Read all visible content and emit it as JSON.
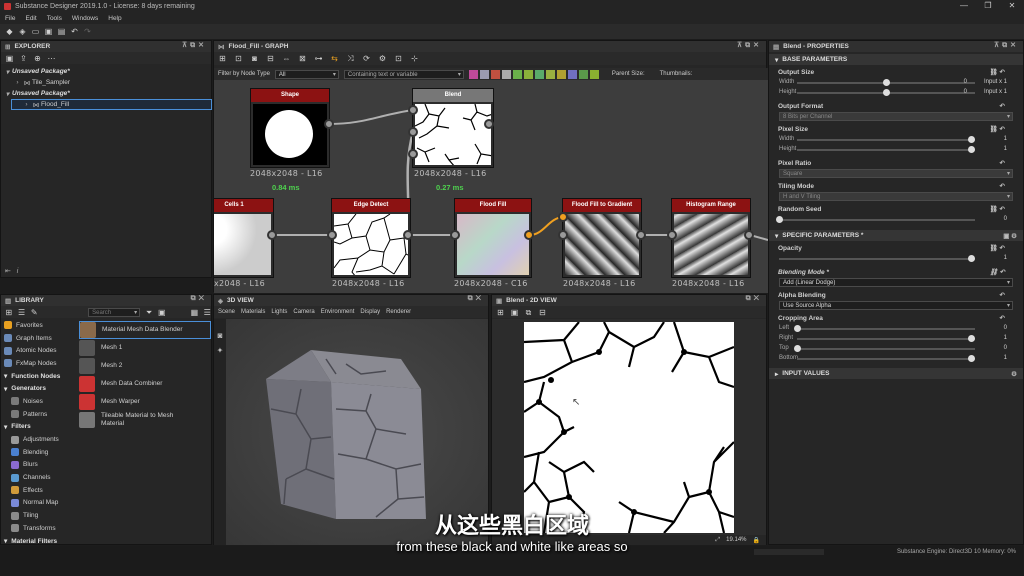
{
  "window": {
    "title": "Substance Designer 2019.1.0 - License: 8 days remaining",
    "controls": [
      "—",
      "❐",
      "✕"
    ]
  },
  "menu": [
    "File",
    "Edit",
    "Tools",
    "Windows",
    "Help"
  ],
  "explorer": {
    "title": "EXPLORER",
    "rows": [
      {
        "label": "Unsaved Package*",
        "type": "pkg"
      },
      {
        "label": "Tile_Sampler",
        "type": "graph"
      },
      {
        "label": "Unsaved Package*",
        "type": "pkg"
      },
      {
        "label": "Flood_Fill",
        "type": "graph",
        "selected": true
      }
    ]
  },
  "graph": {
    "title": "Flood_Fill - GRAPH",
    "filter_label": "Filter by Node Type",
    "filter_value": "All",
    "search_placeholder": "Containing text or variable",
    "parent_size_label": "Parent Size:",
    "thumbnails_label": "Thumbnails:",
    "nodes": {
      "shape": {
        "title": "Shape",
        "size": "2048x2048 - L16",
        "time": "0.84 ms"
      },
      "blend": {
        "title": "Blend",
        "size": "2048x2048 - L16",
        "time": "0.27 ms"
      },
      "cells": {
        "title": "Cells 1",
        "size": "x2048 - L16"
      },
      "edge": {
        "title": "Edge Detect",
        "size": "2048x2048 - L16"
      },
      "flood": {
        "title": "Flood Fill",
        "size": "2048x2048 - C16"
      },
      "ffgrad": {
        "title": "Flood Fill to Gradient",
        "size": "2048x2048 - L16"
      },
      "hist": {
        "title": "Histogram Range",
        "size": "2048x2048 - L16"
      }
    }
  },
  "properties": {
    "title": "Blend - PROPERTIES",
    "base_header": "BASE PARAMETERS",
    "output_size": {
      "label": "Output Size",
      "width_label": "Width",
      "width_value": "0",
      "width_extra": "Input x 1",
      "height_label": "Height",
      "height_value": "0",
      "height_extra": "Input x 1",
      "width_level": 0.5,
      "height_level": 0.5
    },
    "output_format": {
      "label": "Output Format",
      "value": "8 Bits per Channel"
    },
    "pixel_size": {
      "label": "Pixel Size",
      "width_label": "Width",
      "width_value": "1",
      "height_label": "Height",
      "height_value": "1",
      "width_level": 0.98,
      "height_level": 0.98
    },
    "pixel_ratio": {
      "label": "Pixel Ratio",
      "value": "Square"
    },
    "tiling_mode": {
      "label": "Tiling Mode",
      "value": "H and V Tiling"
    },
    "random_seed": {
      "label": "Random Seed",
      "value": "0",
      "level": 0.0
    },
    "specific_header": "SPECIFIC PARAMETERS *",
    "opacity": {
      "label": "Opacity",
      "value": "1",
      "level": 0.98
    },
    "blending_mode": {
      "label": "Blending Mode *",
      "value": "Add (Linear Dodge)"
    },
    "alpha_blending": {
      "label": "Alpha Blending",
      "value": "Use Source Alpha"
    },
    "cropping": {
      "label": "Cropping Area",
      "left_label": "Left",
      "left_value": "0",
      "right_label": "Right",
      "right_value": "1",
      "top_label": "Top",
      "top_value": "0",
      "bottom_label": "Bottom",
      "bottom_value": "1",
      "left_level": 0.0,
      "right_level": 0.98,
      "top_level": 0.0,
      "bottom_level": 0.98
    },
    "input_header": "INPUT VALUES"
  },
  "library": {
    "title": "LIBRARY",
    "search_placeholder": "Search",
    "categories": [
      {
        "label": "Favorites",
        "color": "#e8a020",
        "bold": false
      },
      {
        "label": "Graph Items",
        "color": "#6a8ab8",
        "bold": false
      },
      {
        "label": "Atomic Nodes",
        "color": "#6a8ab8",
        "bold": false
      },
      {
        "label": "FxMap Nodes",
        "color": "#6a8ab8",
        "bold": false
      },
      {
        "label": "Function Nodes",
        "color": "#5f5f5f",
        "bold": true
      },
      {
        "label": "Generators",
        "color": "#5f5f5f",
        "bold": true
      },
      {
        "label": "Noises",
        "color": "#7a7a7a",
        "bold": false
      },
      {
        "label": "Patterns",
        "color": "#7a7a7a",
        "bold": false
      },
      {
        "label": "Filters",
        "color": "#5f5f5f",
        "bold": true
      },
      {
        "label": "Adjustments",
        "color": "#9a9a9a",
        "bold": false
      },
      {
        "label": "Blending",
        "color": "#4a80d0",
        "bold": false
      },
      {
        "label": "Blurs",
        "color": "#8a6ad0",
        "bold": false
      },
      {
        "label": "Channels",
        "color": "#5a9ad0",
        "bold": false
      },
      {
        "label": "Effects",
        "color": "#d09a3a",
        "bold": false
      },
      {
        "label": "Normal Map",
        "color": "#7a8ad8",
        "bold": false
      },
      {
        "label": "Tiling",
        "color": "#8a8a8a",
        "bold": false
      },
      {
        "label": "Transforms",
        "color": "#8a8a8a",
        "bold": false
      },
      {
        "label": "Material Filters",
        "color": "#5f5f5f",
        "bold": true
      }
    ],
    "items": [
      {
        "label": "Material Mesh Data Blender",
        "color": "#8a6a4a"
      },
      {
        "label": "Mesh 1",
        "color": "#555555"
      },
      {
        "label": "Mesh 2",
        "color": "#555555"
      },
      {
        "label": "Mesh Data Combiner",
        "color": "#cc3333"
      },
      {
        "label": "Mesh Warper",
        "color": "#cc3333"
      },
      {
        "label": "Tileable Material to Mesh Material",
        "color": "#777777"
      }
    ]
  },
  "view3d": {
    "title": "3D VIEW",
    "menu": [
      "Scene",
      "Materials",
      "Lights",
      "Camera",
      "Environment",
      "Display",
      "Renderer"
    ]
  },
  "view2d": {
    "title": "Blend - 2D VIEW",
    "zoom": "19.14%"
  },
  "status": {
    "engine": "Substance Engine: Direct3D 10  Memory: 0%"
  },
  "subtitles": {
    "cn": "从这些黑白区域",
    "en": "from these black and white like areas so"
  }
}
